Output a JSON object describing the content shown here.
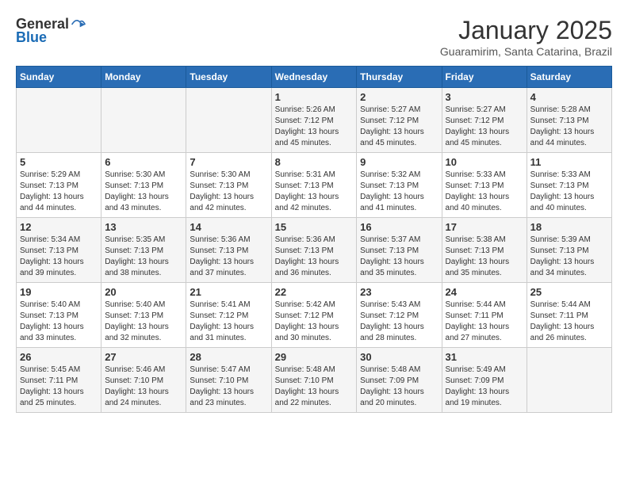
{
  "header": {
    "logo_general": "General",
    "logo_blue": "Blue",
    "month_year": "January 2025",
    "location": "Guaramirim, Santa Catarina, Brazil"
  },
  "weekdays": [
    "Sunday",
    "Monday",
    "Tuesday",
    "Wednesday",
    "Thursday",
    "Friday",
    "Saturday"
  ],
  "weeks": [
    [
      {
        "day": "",
        "sunrise": "",
        "sunset": "",
        "daylight": ""
      },
      {
        "day": "",
        "sunrise": "",
        "sunset": "",
        "daylight": ""
      },
      {
        "day": "",
        "sunrise": "",
        "sunset": "",
        "daylight": ""
      },
      {
        "day": "1",
        "sunrise": "Sunrise: 5:26 AM",
        "sunset": "Sunset: 7:12 PM",
        "daylight": "Daylight: 13 hours and 45 minutes."
      },
      {
        "day": "2",
        "sunrise": "Sunrise: 5:27 AM",
        "sunset": "Sunset: 7:12 PM",
        "daylight": "Daylight: 13 hours and 45 minutes."
      },
      {
        "day": "3",
        "sunrise": "Sunrise: 5:27 AM",
        "sunset": "Sunset: 7:12 PM",
        "daylight": "Daylight: 13 hours and 45 minutes."
      },
      {
        "day": "4",
        "sunrise": "Sunrise: 5:28 AM",
        "sunset": "Sunset: 7:13 PM",
        "daylight": "Daylight: 13 hours and 44 minutes."
      }
    ],
    [
      {
        "day": "5",
        "sunrise": "Sunrise: 5:29 AM",
        "sunset": "Sunset: 7:13 PM",
        "daylight": "Daylight: 13 hours and 44 minutes."
      },
      {
        "day": "6",
        "sunrise": "Sunrise: 5:30 AM",
        "sunset": "Sunset: 7:13 PM",
        "daylight": "Daylight: 13 hours and 43 minutes."
      },
      {
        "day": "7",
        "sunrise": "Sunrise: 5:30 AM",
        "sunset": "Sunset: 7:13 PM",
        "daylight": "Daylight: 13 hours and 42 minutes."
      },
      {
        "day": "8",
        "sunrise": "Sunrise: 5:31 AM",
        "sunset": "Sunset: 7:13 PM",
        "daylight": "Daylight: 13 hours and 42 minutes."
      },
      {
        "day": "9",
        "sunrise": "Sunrise: 5:32 AM",
        "sunset": "Sunset: 7:13 PM",
        "daylight": "Daylight: 13 hours and 41 minutes."
      },
      {
        "day": "10",
        "sunrise": "Sunrise: 5:33 AM",
        "sunset": "Sunset: 7:13 PM",
        "daylight": "Daylight: 13 hours and 40 minutes."
      },
      {
        "day": "11",
        "sunrise": "Sunrise: 5:33 AM",
        "sunset": "Sunset: 7:13 PM",
        "daylight": "Daylight: 13 hours and 40 minutes."
      }
    ],
    [
      {
        "day": "12",
        "sunrise": "Sunrise: 5:34 AM",
        "sunset": "Sunset: 7:13 PM",
        "daylight": "Daylight: 13 hours and 39 minutes."
      },
      {
        "day": "13",
        "sunrise": "Sunrise: 5:35 AM",
        "sunset": "Sunset: 7:13 PM",
        "daylight": "Daylight: 13 hours and 38 minutes."
      },
      {
        "day": "14",
        "sunrise": "Sunrise: 5:36 AM",
        "sunset": "Sunset: 7:13 PM",
        "daylight": "Daylight: 13 hours and 37 minutes."
      },
      {
        "day": "15",
        "sunrise": "Sunrise: 5:36 AM",
        "sunset": "Sunset: 7:13 PM",
        "daylight": "Daylight: 13 hours and 36 minutes."
      },
      {
        "day": "16",
        "sunrise": "Sunrise: 5:37 AM",
        "sunset": "Sunset: 7:13 PM",
        "daylight": "Daylight: 13 hours and 35 minutes."
      },
      {
        "day": "17",
        "sunrise": "Sunrise: 5:38 AM",
        "sunset": "Sunset: 7:13 PM",
        "daylight": "Daylight: 13 hours and 35 minutes."
      },
      {
        "day": "18",
        "sunrise": "Sunrise: 5:39 AM",
        "sunset": "Sunset: 7:13 PM",
        "daylight": "Daylight: 13 hours and 34 minutes."
      }
    ],
    [
      {
        "day": "19",
        "sunrise": "Sunrise: 5:40 AM",
        "sunset": "Sunset: 7:13 PM",
        "daylight": "Daylight: 13 hours and 33 minutes."
      },
      {
        "day": "20",
        "sunrise": "Sunrise: 5:40 AM",
        "sunset": "Sunset: 7:13 PM",
        "daylight": "Daylight: 13 hours and 32 minutes."
      },
      {
        "day": "21",
        "sunrise": "Sunrise: 5:41 AM",
        "sunset": "Sunset: 7:12 PM",
        "daylight": "Daylight: 13 hours and 31 minutes."
      },
      {
        "day": "22",
        "sunrise": "Sunrise: 5:42 AM",
        "sunset": "Sunset: 7:12 PM",
        "daylight": "Daylight: 13 hours and 30 minutes."
      },
      {
        "day": "23",
        "sunrise": "Sunrise: 5:43 AM",
        "sunset": "Sunset: 7:12 PM",
        "daylight": "Daylight: 13 hours and 28 minutes."
      },
      {
        "day": "24",
        "sunrise": "Sunrise: 5:44 AM",
        "sunset": "Sunset: 7:11 PM",
        "daylight": "Daylight: 13 hours and 27 minutes."
      },
      {
        "day": "25",
        "sunrise": "Sunrise: 5:44 AM",
        "sunset": "Sunset: 7:11 PM",
        "daylight": "Daylight: 13 hours and 26 minutes."
      }
    ],
    [
      {
        "day": "26",
        "sunrise": "Sunrise: 5:45 AM",
        "sunset": "Sunset: 7:11 PM",
        "daylight": "Daylight: 13 hours and 25 minutes."
      },
      {
        "day": "27",
        "sunrise": "Sunrise: 5:46 AM",
        "sunset": "Sunset: 7:10 PM",
        "daylight": "Daylight: 13 hours and 24 minutes."
      },
      {
        "day": "28",
        "sunrise": "Sunrise: 5:47 AM",
        "sunset": "Sunset: 7:10 PM",
        "daylight": "Daylight: 13 hours and 23 minutes."
      },
      {
        "day": "29",
        "sunrise": "Sunrise: 5:48 AM",
        "sunset": "Sunset: 7:10 PM",
        "daylight": "Daylight: 13 hours and 22 minutes."
      },
      {
        "day": "30",
        "sunrise": "Sunrise: 5:48 AM",
        "sunset": "Sunset: 7:09 PM",
        "daylight": "Daylight: 13 hours and 20 minutes."
      },
      {
        "day": "31",
        "sunrise": "Sunrise: 5:49 AM",
        "sunset": "Sunset: 7:09 PM",
        "daylight": "Daylight: 13 hours and 19 minutes."
      },
      {
        "day": "",
        "sunrise": "",
        "sunset": "",
        "daylight": ""
      }
    ]
  ]
}
